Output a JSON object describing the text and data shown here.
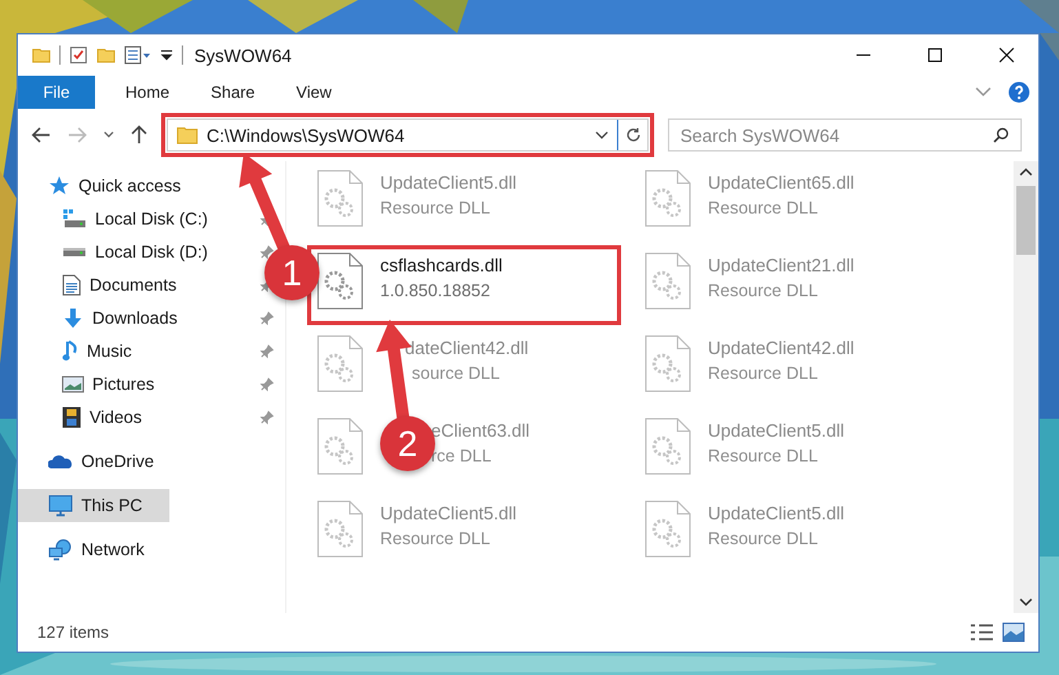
{
  "window": {
    "title": "SysWOW64"
  },
  "ribbon_tabs": [
    {
      "label": "File",
      "selected": true
    },
    {
      "label": "Home",
      "selected": false
    },
    {
      "label": "Share",
      "selected": false
    },
    {
      "label": "View",
      "selected": false
    }
  ],
  "address_bar": {
    "path": "C:\\Windows\\SysWOW64",
    "highlighted": true
  },
  "search": {
    "placeholder": "Search SysWOW64"
  },
  "sidebar": {
    "items": [
      {
        "label": "Quick access",
        "kind": "star",
        "selected": false,
        "children": [
          {
            "label": "Local Disk (C:)",
            "kind": "system-drive",
            "pinned": true,
            "selected": false
          },
          {
            "label": "Local Disk (D:)",
            "kind": "drive",
            "pinned": true,
            "selected": false
          },
          {
            "label": "Documents",
            "kind": "documents",
            "pinned": true,
            "selected": false
          },
          {
            "label": "Downloads",
            "kind": "downloads",
            "pinned": true,
            "selected": false
          },
          {
            "label": "Music",
            "kind": "music",
            "pinned": true,
            "selected": false
          },
          {
            "label": "Pictures",
            "kind": "pictures",
            "pinned": true,
            "selected": false
          },
          {
            "label": "Videos",
            "kind": "videos",
            "pinned": true,
            "selected": false
          }
        ]
      },
      {
        "label": "OneDrive",
        "kind": "cloud",
        "selected": false
      },
      {
        "label": "This PC",
        "kind": "computer",
        "selected": true
      },
      {
        "label": "Network",
        "kind": "network",
        "selected": false
      }
    ]
  },
  "files": [
    {
      "name": "UpdateClient5.dll",
      "detail": "Resource DLL",
      "blurred": true,
      "highlighted": false,
      "kind": "plain"
    },
    {
      "name": "UpdateClient65.dll",
      "detail": "Resource DLL",
      "blurred": true,
      "highlighted": false,
      "kind": "plain"
    },
    {
      "name": "csflashcards.dll",
      "detail": "1.0.850.18852",
      "blurred": false,
      "highlighted": true,
      "kind": "plain"
    },
    {
      "name": "UpdateClient21.dll",
      "detail": "Resource DLL",
      "blurred": true,
      "highlighted": false,
      "kind": "plain"
    },
    {
      "name": "dateClient42.dll",
      "detail": "source DLL",
      "blurred": true,
      "highlighted": false,
      "kind": "arrow-covered"
    },
    {
      "name": "UpdateClient42.dll",
      "detail": "Resource DLL",
      "blurred": true,
      "highlighted": false,
      "kind": "plain"
    },
    {
      "name": "eClient63.dll",
      "detail": "rce DLL",
      "blurred": true,
      "highlighted": false,
      "kind": "badge-covered"
    },
    {
      "name": "UpdateClient5.dll",
      "detail": "Resource DLL",
      "blurred": true,
      "highlighted": false,
      "kind": "plain"
    },
    {
      "name": "UpdateClient5.dll",
      "detail": "Resource DLL",
      "blurred": true,
      "highlighted": false,
      "kind": "plain"
    },
    {
      "name": "UpdateClient5.dll",
      "detail": "Resource DLL",
      "blurred": true,
      "highlighted": false,
      "kind": "plain"
    }
  ],
  "annotations": [
    {
      "label": "1"
    },
    {
      "label": "2"
    }
  ],
  "status_bar": {
    "item_count": "127 items"
  }
}
